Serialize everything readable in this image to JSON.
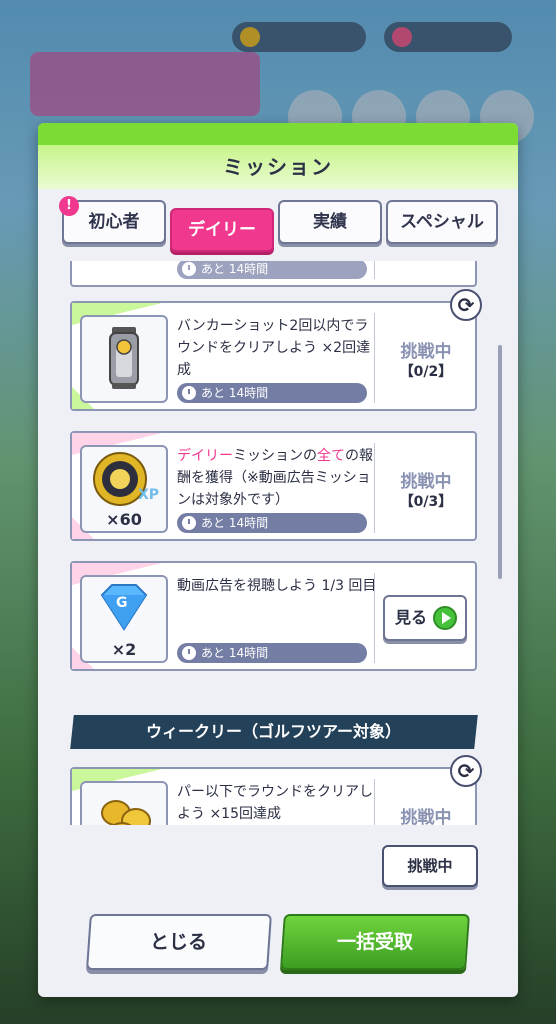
{
  "panel": {
    "title": "ミッション"
  },
  "tabs": [
    {
      "label": "初心者",
      "badge": "!"
    },
    {
      "label": "デイリー",
      "active": true
    },
    {
      "label": "実績"
    },
    {
      "label": "スペシャル"
    }
  ],
  "partial_top": {
    "time": "あと 14時間"
  },
  "missions": [
    {
      "desc": "バンカーショット2回以内でラウンドをクリアしよう ×2回達成",
      "time": "あと 14時間",
      "status": "挑戦中",
      "progress": "【0/2】",
      "icon": "golf-bag-icon",
      "qty": ""
    },
    {
      "desc_hl1": "デイリー",
      "desc_mid": "ミッションの",
      "desc_hl2": "全て",
      "desc_rest": "の報酬を獲得（※動画広告ミッションは対象外です）",
      "time": "あと 14時間",
      "status": "挑戦中",
      "progress": "【0/3】",
      "icon": "xp-medal-icon",
      "qty": "×60"
    },
    {
      "desc": "動画広告を視聴しよう 1/3 回目",
      "time": "あと 14時間",
      "button": "見る",
      "icon": "gem-icon",
      "qty": "×2"
    }
  ],
  "weekly": {
    "header": "ウィークリー（ゴルフツアー対象）",
    "desc": "パー以下でラウンドをクリアしよう ×15回達成",
    "status": "挑戦中",
    "icon": "gold-coins-icon"
  },
  "footer": {
    "filter_label": "挑戦中",
    "close_label": "とじる",
    "claim_label": "一括受取"
  },
  "colors": {
    "accent_pink": "#f0388f",
    "header_green": "#7ddc33",
    "claim_green": "#3c9e22"
  }
}
